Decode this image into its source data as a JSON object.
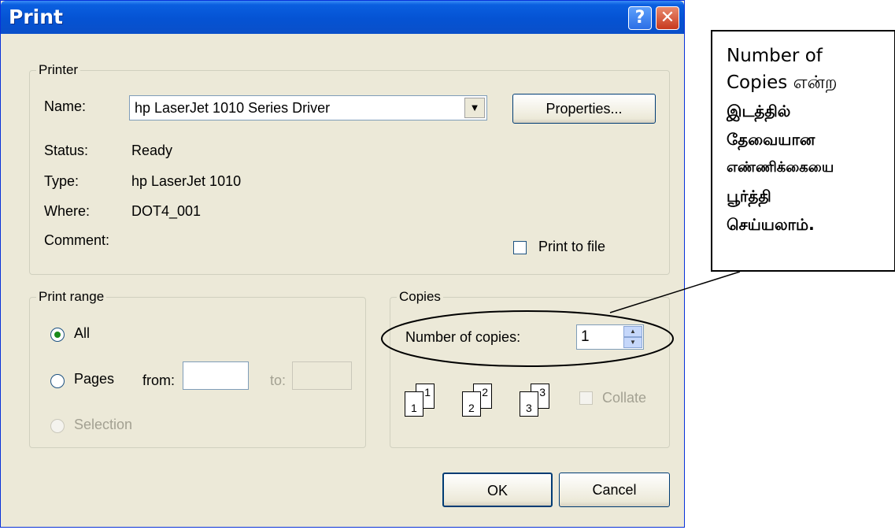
{
  "window": {
    "title": "Print",
    "help_label": "?",
    "close_label": "✕"
  },
  "printer": {
    "legend": "Printer",
    "name_label": "Name:",
    "name_value": "hp LaserJet 1010 Series Driver",
    "properties_label": "Properties...",
    "status_label": "Status:",
    "status_value": "Ready",
    "type_label": "Type:",
    "type_value": "hp LaserJet 1010",
    "where_label": "Where:",
    "where_value": "DOT4_001",
    "comment_label": "Comment:",
    "print_to_file_label": "Print to file"
  },
  "print_range": {
    "legend": "Print range",
    "all_label": "All",
    "pages_label": "Pages",
    "from_label": "from:",
    "to_label": "to:",
    "selection_label": "Selection"
  },
  "copies": {
    "legend": "Copies",
    "number_label": "Number of copies:",
    "number_value": "1",
    "collate_label": "Collate",
    "stack_numbers": [
      "1",
      "1",
      "2",
      "2",
      "3",
      "3"
    ]
  },
  "buttons": {
    "ok_label": "OK",
    "cancel_label": "Cancel"
  },
  "callout": {
    "lines": [
      "Number of",
      "Copies என்ற",
      "இடத்தில்",
      "தேவையான",
      "எண்ணிக்கையை",
      "பூர்த்தி",
      "செய்யலாம்."
    ]
  }
}
